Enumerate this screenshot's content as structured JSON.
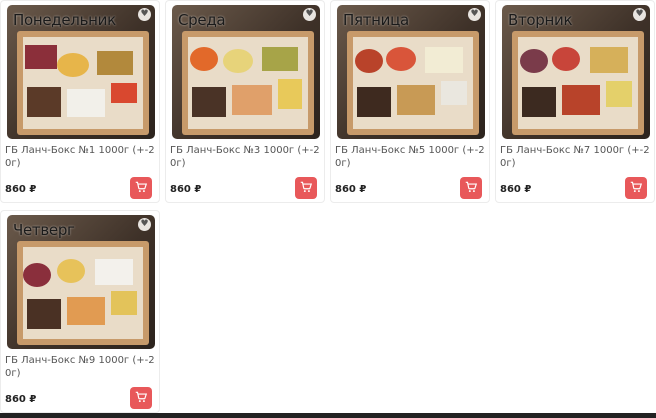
{
  "products": [
    {
      "day": "Понедельник",
      "title": "ГБ Ланч-Бокс №1 1000г (+-20г)",
      "price": "860 ₽"
    },
    {
      "day": "Среда",
      "title": "ГБ Ланч-Бокс №3 1000г (+-20г)",
      "price": "860 ₽"
    },
    {
      "day": "Пятница",
      "title": "ГБ Ланч-Бокс №5 1000г (+-20г)",
      "price": "860 ₽"
    },
    {
      "day": "Вторник",
      "title": "ГБ Ланч-Бокс №7 1000г (+-20г)",
      "price": "860 ₽"
    },
    {
      "day": "Четверг",
      "title": "ГБ Ланч-Бокс №9 1000г (+-20г)",
      "price": "860 ₽"
    }
  ],
  "icons": {
    "favorite": "heart-icon",
    "cart": "cart-icon"
  },
  "colors": {
    "accent": "#e8585a"
  }
}
